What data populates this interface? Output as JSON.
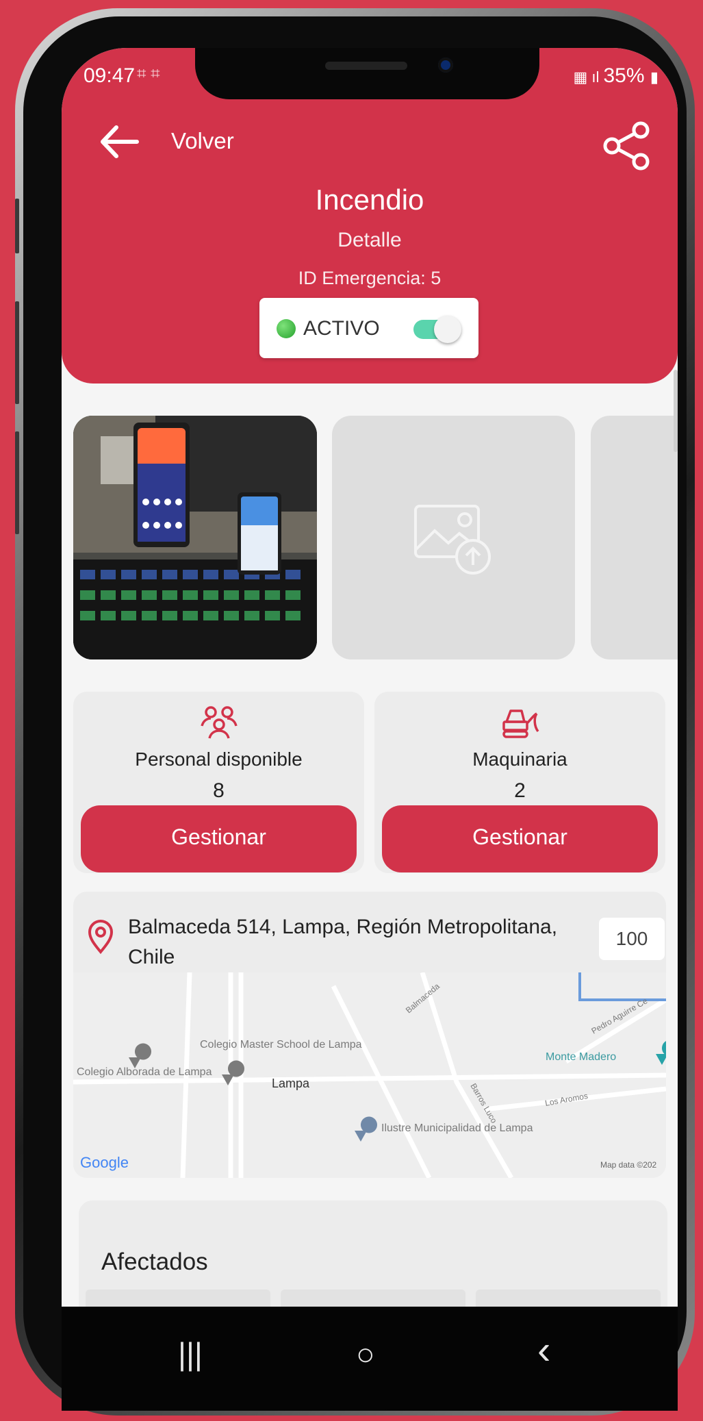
{
  "colors": {
    "accent": "#d2334a",
    "toggle_on": "#5ad4ad",
    "status_dot": "#2fae3a"
  },
  "status_bar": {
    "time": "09:47",
    "battery": "35%"
  },
  "header": {
    "back_label": "Volver",
    "title": "Incendio",
    "subtitle": "Detalle",
    "emergency_id": "ID Emergencia: 5",
    "status_label": "ACTIVO",
    "status_active": true
  },
  "icons": {
    "back": "arrow-left-icon",
    "share": "share-icon",
    "personal": "people-icon",
    "machinery": "excavator-icon",
    "location": "location-pin-icon",
    "image_placeholder": "image-upload-icon"
  },
  "gallery": [
    {
      "type": "photo",
      "alt": "Foto de la emergencia"
    },
    {
      "type": "placeholder"
    },
    {
      "type": "placeholder"
    }
  ],
  "resources": [
    {
      "label": "Personal disponible",
      "count": "8",
      "button": "Gestionar"
    },
    {
      "label": "Maquinaria",
      "count": "2",
      "button": "Gestionar"
    }
  ],
  "location": {
    "address": "Balmaceda 514, Lampa, Región Metropolitana, Chile",
    "radius": "100"
  },
  "map": {
    "labels": [
      "Colegio Master School de Lampa",
      "Lampa",
      "Ilustre Municipalidad de Lampa",
      "Monte Madero",
      "Colegio Alborada de Lampa",
      "Balmaceda",
      "Barros Luco",
      "Pedro Aguirre Ce",
      "Los Aromos"
    ],
    "logo": "Google",
    "attribution": "Map data ©202"
  },
  "afectados": {
    "title": "Afectados"
  },
  "navbar": {
    "recent": "|||",
    "home": "○",
    "back": "‹"
  }
}
